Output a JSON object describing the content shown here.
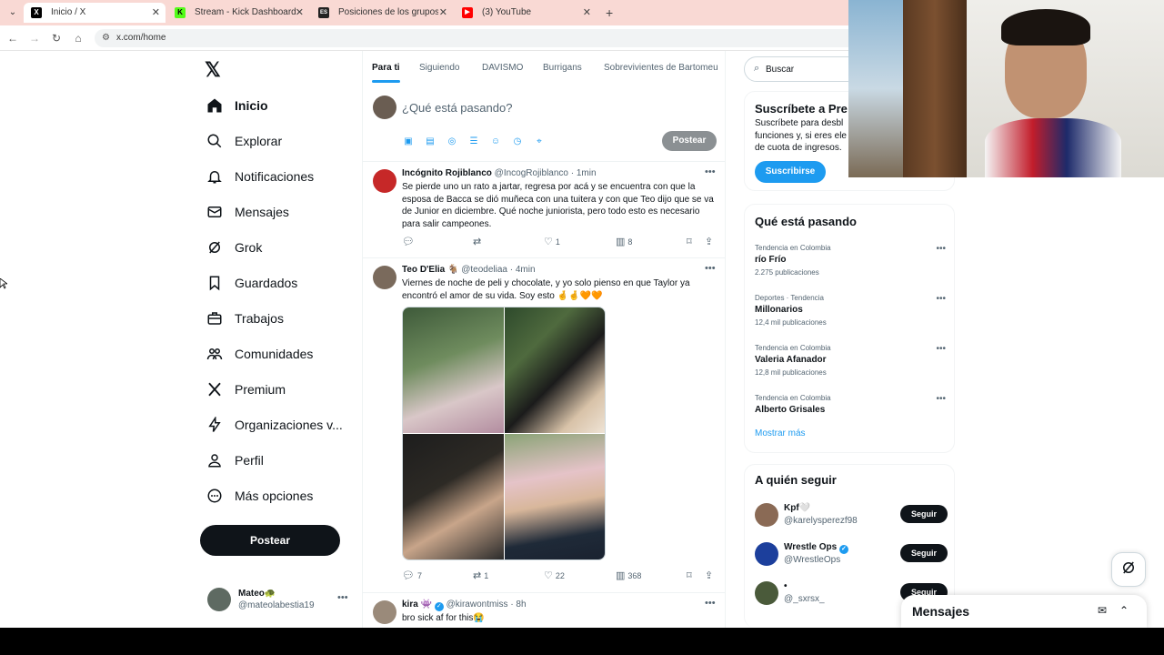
{
  "browser": {
    "tabs": [
      {
        "title": "Inicio / X",
        "favicon": "x-favicon"
      },
      {
        "title": "Stream - Kick Dashboard",
        "favicon": "kick-favicon"
      },
      {
        "title": "Posiciones de los grupos de Lig",
        "favicon": "espn-favicon"
      },
      {
        "title": "(3) YouTube",
        "favicon": "youtube-favicon"
      }
    ],
    "url": "x.com/home"
  },
  "nav": {
    "items": [
      {
        "label": "Inicio",
        "icon": "home-icon"
      },
      {
        "label": "Explorar",
        "icon": "search-icon"
      },
      {
        "label": "Notificaciones",
        "icon": "bell-icon"
      },
      {
        "label": "Mensajes",
        "icon": "mail-icon"
      },
      {
        "label": "Grok",
        "icon": "grok-icon"
      },
      {
        "label": "Guardados",
        "icon": "bookmark-icon"
      },
      {
        "label": "Trabajos",
        "icon": "briefcase-icon"
      },
      {
        "label": "Comunidades",
        "icon": "communities-icon"
      },
      {
        "label": "Premium",
        "icon": "x-premium-icon"
      },
      {
        "label": "Organizaciones v...",
        "icon": "lightning-icon"
      },
      {
        "label": "Perfil",
        "icon": "person-icon"
      },
      {
        "label": "Más opciones",
        "icon": "more-circle-icon"
      }
    ],
    "post_label": "Postear",
    "account": {
      "name": "Mateo🐢",
      "handle": "@mateolabestia19"
    }
  },
  "feed": {
    "tabs": [
      "Para ti",
      "Siguiendo",
      "DAVISMO",
      "Burrigans",
      "Sobrevivientes de Bartomeu"
    ],
    "composer": {
      "prompt": "¿Qué está pasando?",
      "post_label": "Postear"
    },
    "tweets": [
      {
        "name": "Incógnito Rojiblanco",
        "handle": "@IncogRojiblanco",
        "time": "· 1min",
        "text": "Se pierde uno un rato a jartar, regresa por acá y se encuentra con que la esposa de Bacca se dió muñeca con una tuitera y con que Teo dijo que se va de Junior en diciembre. Qué noche juniorista, pero todo esto es necesario para salir campeones.",
        "likes": "1",
        "views": "8"
      },
      {
        "name": "Teo D'Elia",
        "badge": "🐐",
        "handle": "@teodeliaa",
        "time": "· 4min",
        "text": "Viernes de noche de peli y chocolate, y yo solo pienso en que Taylor ya encontró el amor de su vida. Soy esto 🤞🤞🧡🧡",
        "replies": "7",
        "reposts": "1",
        "likes": "22",
        "views": "368"
      },
      {
        "name": "kira 👾",
        "handle": "@kirawontmiss",
        "time": "· 8h",
        "text": "bro sick af for this😭"
      }
    ]
  },
  "sidebar": {
    "search_placeholder": "Buscar",
    "subscribe": {
      "title": "Suscríbete a Pre",
      "desc": "Suscríbete para desbl funciones y, si eres ele de cuota de ingresos.",
      "button": "Suscribirse"
    },
    "trending": {
      "title": "Qué está pasando",
      "items": [
        {
          "context": "Tendencia en Colombia",
          "title": "río Frío",
          "count": "2.275 publicaciones"
        },
        {
          "context": "Deportes · Tendencia",
          "title": "Millonarios",
          "count": "12,4 mil publicaciones"
        },
        {
          "context": "Tendencia en Colombia",
          "title": "Valeria Afanador",
          "count": "12,8 mil publicaciones"
        },
        {
          "context": "Tendencia en Colombia",
          "title": "Alberto Grisales",
          "count": ""
        }
      ],
      "show_more": "Mostrar más"
    },
    "who_to_follow": {
      "title": "A quién seguir",
      "users": [
        {
          "name": "Kpf🤍",
          "handle": "@karelysperezf98",
          "button": "Seguir"
        },
        {
          "name": "Wrestle Ops",
          "handle": "@WrestleOps",
          "button": "Seguir",
          "verified": true
        },
        {
          "name": "•",
          "handle": "@_sxrsx_",
          "button": "Seguir"
        }
      ]
    }
  },
  "messages_drawer": {
    "title": "Mensajes"
  },
  "colors": {
    "accent": "#1d9bf0",
    "text": "#0f1419",
    "muted": "#536471",
    "tabstrip": "#f9d9d4"
  }
}
